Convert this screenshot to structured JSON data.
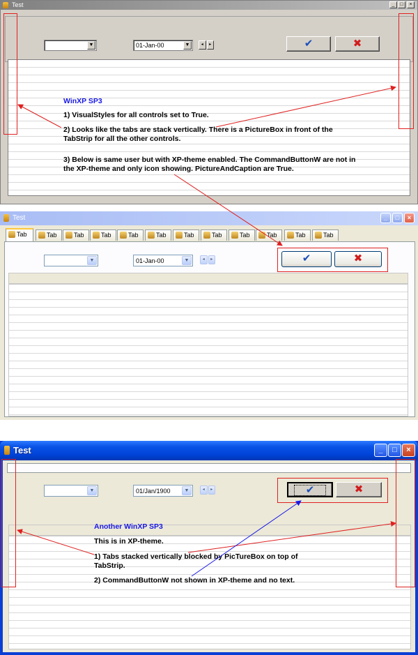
{
  "window1": {
    "title": "Test",
    "combo_date": "01-Jan-00",
    "ok_glyph": "✔",
    "cancel_glyph": "✖",
    "notes": {
      "heading": "WinXP SP3",
      "line1": "1) VisualStyles for all controls set to True.",
      "line2a": "2) Looks like the tabs are stack vertically. There is a PictureBox in front of the",
      "line2b": "TabStrip for all the other controls.",
      "line3a": "3) Below is same user but with XP-theme enabled. The CommandButtonW are not in",
      "line3b": "the XP-theme and only icon showing. PictureAndCaption are True."
    }
  },
  "window2": {
    "title": "Test",
    "tabs": [
      "Tab",
      "Tab",
      "Tab",
      "Tab",
      "Tab",
      "Tab",
      "Tab",
      "Tab",
      "Tab",
      "Tab",
      "Tab",
      "Tab"
    ],
    "combo_date": "01-Jan-00",
    "ok_glyph": "✔",
    "cancel_glyph": "✖"
  },
  "window3": {
    "title": "Test",
    "combo_date": "01/Jan/1900",
    "ok_glyph": "✔",
    "cancel_glyph": "✖",
    "notes": {
      "heading": "Another WinXP SP3",
      "line1": "This is in XP-theme.",
      "line2a": "1) Tabs stacked vertically blocked by PicTureBox on top of",
      "line2b": "TabStrip.",
      "line3": "2) CommandButtonW not shown in XP-theme and no text."
    }
  },
  "icons": {
    "app": "app-icon",
    "dropdown": "chevron-down-icon",
    "spin_left": "arrow-left-icon",
    "spin_right": "arrow-right-icon",
    "minimize": "minimize-icon",
    "maximize": "maximize-icon",
    "close": "close-icon",
    "ok": "checkmark-icon",
    "cancel": "cross-icon"
  },
  "colors": {
    "annotation_red": "#e02020",
    "annotation_blue": "#1919e6",
    "xp_titlebar": "#0a53e6",
    "classic_face": "#d4d0c8"
  }
}
